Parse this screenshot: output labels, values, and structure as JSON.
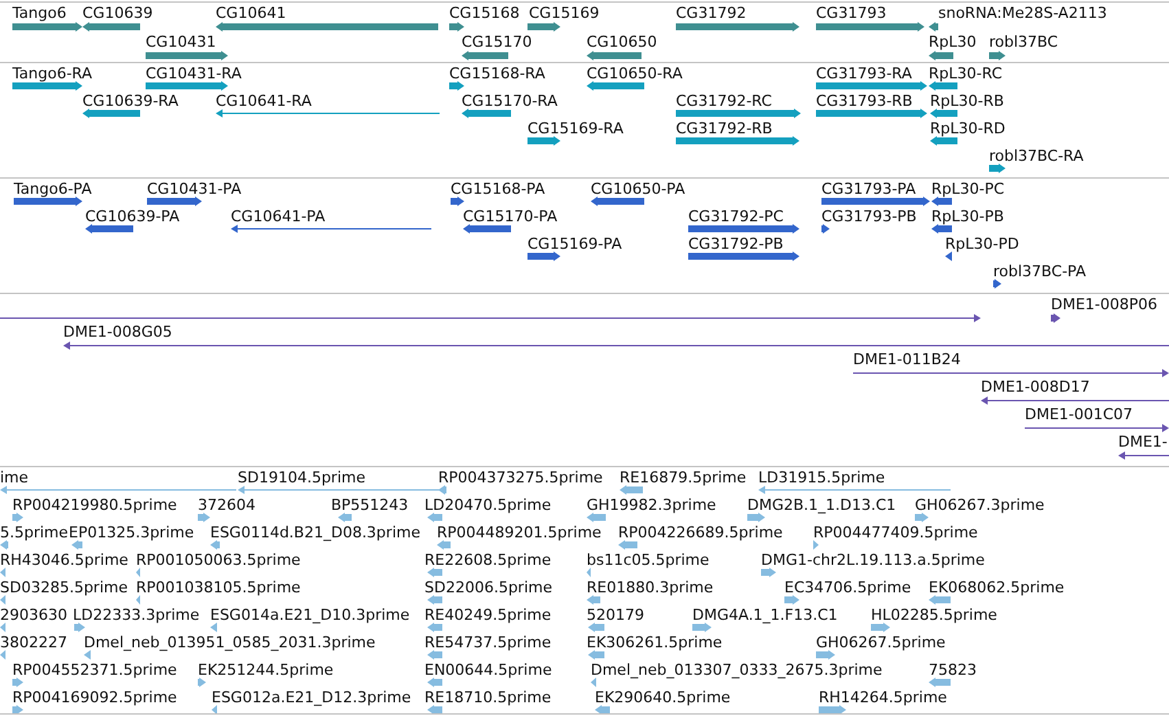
{
  "tracks": [
    {
      "kind": "gene",
      "color": "#3f8f91",
      "lanes": [
        {
          "features": [
            {
              "label": "Tango6",
              "reverse": false
            },
            {
              "label": "CG10639",
              "reverse": true
            },
            {
              "label": "CG10641",
              "reverse": true
            },
            {
              "label": "CG15168",
              "reverse": false
            },
            {
              "label": "CG15169",
              "reverse": false
            },
            {
              "label": "CG31792",
              "reverse": false
            },
            {
              "label": "CG31793",
              "reverse": false
            },
            {
              "label": "snoRNA:Me28S-A2113",
              "reverse": true
            }
          ]
        },
        {
          "features": [
            {
              "label": "CG10431",
              "reverse": false
            },
            {
              "label": "CG15170",
              "reverse": true
            },
            {
              "label": "CG10650",
              "reverse": true
            },
            {
              "label": "RpL30",
              "reverse": true
            },
            {
              "label": "robl37BC",
              "reverse": false
            }
          ]
        }
      ]
    },
    {
      "kind": "transcript",
      "color": "#14a0bf",
      "lanes": [
        {
          "features": [
            {
              "label": "Tango6-RA",
              "reverse": false
            },
            {
              "label": "CG10431-RA",
              "reverse": false
            },
            {
              "label": "CG15168-RA",
              "reverse": false
            },
            {
              "label": "CG10650-RA",
              "reverse": true
            },
            {
              "label": "CG31793-RA",
              "reverse": false
            },
            {
              "label": "RpL30-RC",
              "reverse": true
            }
          ]
        },
        {
          "features": [
            {
              "label": "CG10639-RA",
              "reverse": true
            },
            {
              "label": "CG10641-RA",
              "reverse": true
            },
            {
              "label": "CG15170-RA",
              "reverse": true
            },
            {
              "label": "CG31792-RC",
              "reverse": false
            },
            {
              "label": "CG31793-RB",
              "reverse": false
            },
            {
              "label": "RpL30-RB",
              "reverse": true
            }
          ]
        },
        {
          "features": [
            {
              "label": "CG15169-RA",
              "reverse": false
            },
            {
              "label": "CG31792-RB",
              "reverse": false
            },
            {
              "label": "RpL30-RD",
              "reverse": true
            }
          ]
        },
        {
          "features": [
            {
              "label": "robl37BC-RA",
              "reverse": false
            }
          ]
        }
      ]
    },
    {
      "kind": "protein",
      "color": "#3366cc",
      "lanes": [
        {
          "features": [
            {
              "label": "Tango6-PA",
              "reverse": false
            },
            {
              "label": "CG10431-PA",
              "reverse": false
            },
            {
              "label": "CG15168-PA",
              "reverse": false
            },
            {
              "label": "CG10650-PA",
              "reverse": true
            },
            {
              "label": "CG31793-PA",
              "reverse": false
            },
            {
              "label": "RpL30-PC",
              "reverse": true
            }
          ]
        },
        {
          "features": [
            {
              "label": "CG10639-PA",
              "reverse": true
            },
            {
              "label": "CG10641-PA",
              "reverse": true
            },
            {
              "label": "CG15170-PA",
              "reverse": true
            },
            {
              "label": "CG31792-PC",
              "reverse": false
            },
            {
              "label": "CG31793-PB",
              "reverse": false
            },
            {
              "label": "RpL30-PB",
              "reverse": true
            }
          ]
        },
        {
          "features": [
            {
              "label": "CG15169-PA",
              "reverse": false
            },
            {
              "label": "CG31792-PB",
              "reverse": false
            },
            {
              "label": "RpL30-PD",
              "reverse": true
            }
          ]
        },
        {
          "features": [
            {
              "label": "robl37BC-PA",
              "reverse": false
            }
          ]
        }
      ]
    },
    {
      "kind": "clone",
      "color": "#6a55b0",
      "lanes": [
        {
          "features": [
            {
              "reverse": false
            },
            {
              "label": "DME1-008P06",
              "reverse": false
            }
          ]
        },
        {
          "features": [
            {
              "label": "DME1-008G05",
              "reverse": true
            }
          ]
        },
        {
          "features": [
            {
              "label": "DME1-011B24",
              "reverse": false
            }
          ]
        },
        {
          "features": [
            {
              "label": "DME1-008D17",
              "reverse": true
            }
          ]
        },
        {
          "features": [
            {
              "label": "DME1-001C07",
              "reverse": false
            }
          ]
        },
        {
          "features": [
            {
              "label": "DME1-",
              "reverse": true
            }
          ]
        }
      ]
    },
    {
      "kind": "est",
      "color": "#86bce0",
      "lanes": [
        {
          "features": [
            {
              "label": "ime",
              "reverse": true
            },
            {
              "label": "SD19104.5prime",
              "reverse": true
            },
            {
              "label": "RP004373275.5prime",
              "reverse": true
            },
            {
              "label": "RE16879.5prime",
              "reverse": true
            },
            {
              "label": "LD31915.5prime",
              "reverse": true
            }
          ]
        },
        {
          "features": [
            {
              "label": "RP004219980.5prime",
              "reverse": false
            },
            {
              "label": "372604",
              "reverse": false
            },
            {
              "label": "BP551243",
              "reverse": true
            },
            {
              "label": "LD20470.5prime",
              "reverse": true
            },
            {
              "label": "GH19982.3prime",
              "reverse": true
            },
            {
              "label": "DMG2B.1_1.D13.C1",
              "reverse": false
            },
            {
              "label": "GH06267.3prime",
              "reverse": false
            }
          ]
        },
        {
          "features": [
            {
              "label": "5.5prime",
              "reverse": true
            },
            {
              "label": "EP01325.3prime",
              "reverse": true
            },
            {
              "label": "ESG0114d.B21_D08.3prime",
              "reverse": true
            },
            {
              "label": "RP004489201.5prime",
              "reverse": true
            },
            {
              "label": "RP004226689.5prime",
              "reverse": true
            },
            {
              "label": "RP004477409.5prime",
              "reverse": false
            }
          ]
        },
        {
          "features": [
            {
              "label": "RH43046.5prime",
              "reverse": true
            },
            {
              "label": "RP001050063.5prime",
              "reverse": true
            },
            {
              "label": "RE22608.5prime",
              "reverse": true
            },
            {
              "label": "bs11c05.5prime",
              "reverse": true
            },
            {
              "label": "DMG1-chr2L.19.113.a.5prime",
              "reverse": false
            }
          ]
        },
        {
          "features": [
            {
              "label": "SD03285.5prime",
              "reverse": true
            },
            {
              "label": "RP001038105.5prime",
              "reverse": true
            },
            {
              "label": "SD22006.5prime",
              "reverse": true
            },
            {
              "label": "RE01880.3prime",
              "reverse": true
            },
            {
              "label": "EC34706.5prime",
              "reverse": false
            },
            {
              "label": "EK068062.5prime",
              "reverse": true
            }
          ]
        },
        {
          "features": [
            {
              "label": "2903630",
              "reverse": true
            },
            {
              "label": "LD22333.3prime",
              "reverse": false
            },
            {
              "label": "ESG014a.E21_D10.3prime",
              "reverse": true
            },
            {
              "label": "RE40249.5prime",
              "reverse": true
            },
            {
              "label": "520179",
              "reverse": true
            },
            {
              "label": "DMG4A.1_1.F13.C1",
              "reverse": false
            },
            {
              "label": "HL02285.5prime",
              "reverse": false
            }
          ]
        },
        {
          "features": [
            {
              "label": "3802227",
              "reverse": true
            },
            {
              "label": "Dmel_neb_013951_0585_2031.3prime",
              "reverse": true
            },
            {
              "label": "RE54737.5prime",
              "reverse": true
            },
            {
              "label": "EK306261.5prime",
              "reverse": true
            },
            {
              "label": "GH06267.5prime",
              "reverse": false
            }
          ]
        },
        {
          "features": [
            {
              "label": "RP004552371.5prime",
              "reverse": false
            },
            {
              "label": "EK251244.5prime",
              "reverse": false
            },
            {
              "label": "EN00644.5prime",
              "reverse": true
            },
            {
              "label": "Dmel_neb_013307_0333_2675.3prime",
              "reverse": true
            },
            {
              "label": "75823",
              "reverse": true
            }
          ]
        },
        {
          "features": [
            {
              "label": "RP004169092.5prime",
              "reverse": false
            },
            {
              "label": "ESG012a.E21_D12.3prime",
              "reverse": true
            },
            {
              "label": "RE18710.5prime",
              "reverse": true
            },
            {
              "label": "EK290640.5prime",
              "reverse": true
            },
            {
              "label": "RH14264.5prime",
              "reverse": false
            }
          ]
        }
      ]
    }
  ]
}
